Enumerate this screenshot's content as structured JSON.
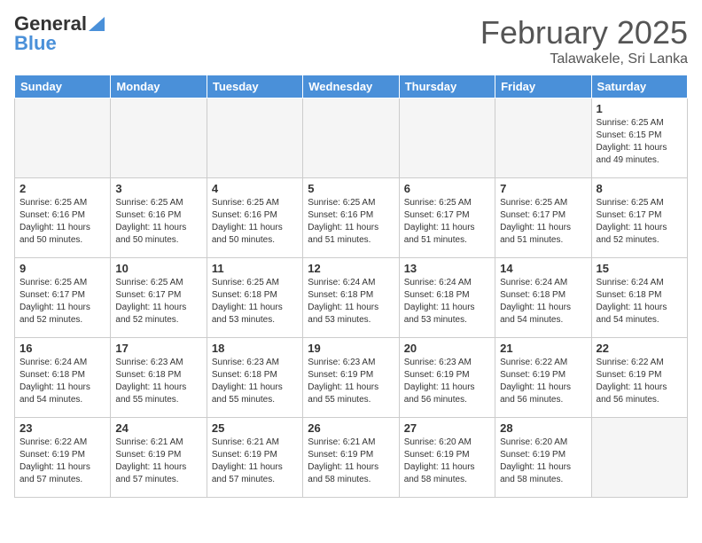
{
  "header": {
    "logo_general": "General",
    "logo_blue": "Blue",
    "month_year": "February 2025",
    "location": "Talawakele, Sri Lanka"
  },
  "weekdays": [
    "Sunday",
    "Monday",
    "Tuesday",
    "Wednesday",
    "Thursday",
    "Friday",
    "Saturday"
  ],
  "weeks": [
    [
      {
        "day": "",
        "empty": true
      },
      {
        "day": "",
        "empty": true
      },
      {
        "day": "",
        "empty": true
      },
      {
        "day": "",
        "empty": true
      },
      {
        "day": "",
        "empty": true
      },
      {
        "day": "",
        "empty": true
      },
      {
        "day": "1",
        "sunrise": "6:25 AM",
        "sunset": "6:15 PM",
        "daylight": "11 hours and 49 minutes."
      }
    ],
    [
      {
        "day": "2",
        "sunrise": "6:25 AM",
        "sunset": "6:16 PM",
        "daylight": "11 hours and 50 minutes."
      },
      {
        "day": "3",
        "sunrise": "6:25 AM",
        "sunset": "6:16 PM",
        "daylight": "11 hours and 50 minutes."
      },
      {
        "day": "4",
        "sunrise": "6:25 AM",
        "sunset": "6:16 PM",
        "daylight": "11 hours and 50 minutes."
      },
      {
        "day": "5",
        "sunrise": "6:25 AM",
        "sunset": "6:16 PM",
        "daylight": "11 hours and 51 minutes."
      },
      {
        "day": "6",
        "sunrise": "6:25 AM",
        "sunset": "6:17 PM",
        "daylight": "11 hours and 51 minutes."
      },
      {
        "day": "7",
        "sunrise": "6:25 AM",
        "sunset": "6:17 PM",
        "daylight": "11 hours and 51 minutes."
      },
      {
        "day": "8",
        "sunrise": "6:25 AM",
        "sunset": "6:17 PM",
        "daylight": "11 hours and 52 minutes."
      }
    ],
    [
      {
        "day": "9",
        "sunrise": "6:25 AM",
        "sunset": "6:17 PM",
        "daylight": "11 hours and 52 minutes."
      },
      {
        "day": "10",
        "sunrise": "6:25 AM",
        "sunset": "6:17 PM",
        "daylight": "11 hours and 52 minutes."
      },
      {
        "day": "11",
        "sunrise": "6:25 AM",
        "sunset": "6:18 PM",
        "daylight": "11 hours and 53 minutes."
      },
      {
        "day": "12",
        "sunrise": "6:24 AM",
        "sunset": "6:18 PM",
        "daylight": "11 hours and 53 minutes."
      },
      {
        "day": "13",
        "sunrise": "6:24 AM",
        "sunset": "6:18 PM",
        "daylight": "11 hours and 53 minutes."
      },
      {
        "day": "14",
        "sunrise": "6:24 AM",
        "sunset": "6:18 PM",
        "daylight": "11 hours and 54 minutes."
      },
      {
        "day": "15",
        "sunrise": "6:24 AM",
        "sunset": "6:18 PM",
        "daylight": "11 hours and 54 minutes."
      }
    ],
    [
      {
        "day": "16",
        "sunrise": "6:24 AM",
        "sunset": "6:18 PM",
        "daylight": "11 hours and 54 minutes."
      },
      {
        "day": "17",
        "sunrise": "6:23 AM",
        "sunset": "6:18 PM",
        "daylight": "11 hours and 55 minutes."
      },
      {
        "day": "18",
        "sunrise": "6:23 AM",
        "sunset": "6:18 PM",
        "daylight": "11 hours and 55 minutes."
      },
      {
        "day": "19",
        "sunrise": "6:23 AM",
        "sunset": "6:19 PM",
        "daylight": "11 hours and 55 minutes."
      },
      {
        "day": "20",
        "sunrise": "6:23 AM",
        "sunset": "6:19 PM",
        "daylight": "11 hours and 56 minutes."
      },
      {
        "day": "21",
        "sunrise": "6:22 AM",
        "sunset": "6:19 PM",
        "daylight": "11 hours and 56 minutes."
      },
      {
        "day": "22",
        "sunrise": "6:22 AM",
        "sunset": "6:19 PM",
        "daylight": "11 hours and 56 minutes."
      }
    ],
    [
      {
        "day": "23",
        "sunrise": "6:22 AM",
        "sunset": "6:19 PM",
        "daylight": "11 hours and 57 minutes."
      },
      {
        "day": "24",
        "sunrise": "6:21 AM",
        "sunset": "6:19 PM",
        "daylight": "11 hours and 57 minutes."
      },
      {
        "day": "25",
        "sunrise": "6:21 AM",
        "sunset": "6:19 PM",
        "daylight": "11 hours and 57 minutes."
      },
      {
        "day": "26",
        "sunrise": "6:21 AM",
        "sunset": "6:19 PM",
        "daylight": "11 hours and 58 minutes."
      },
      {
        "day": "27",
        "sunrise": "6:20 AM",
        "sunset": "6:19 PM",
        "daylight": "11 hours and 58 minutes."
      },
      {
        "day": "28",
        "sunrise": "6:20 AM",
        "sunset": "6:19 PM",
        "daylight": "11 hours and 58 minutes."
      },
      {
        "day": "",
        "empty": true
      }
    ]
  ]
}
